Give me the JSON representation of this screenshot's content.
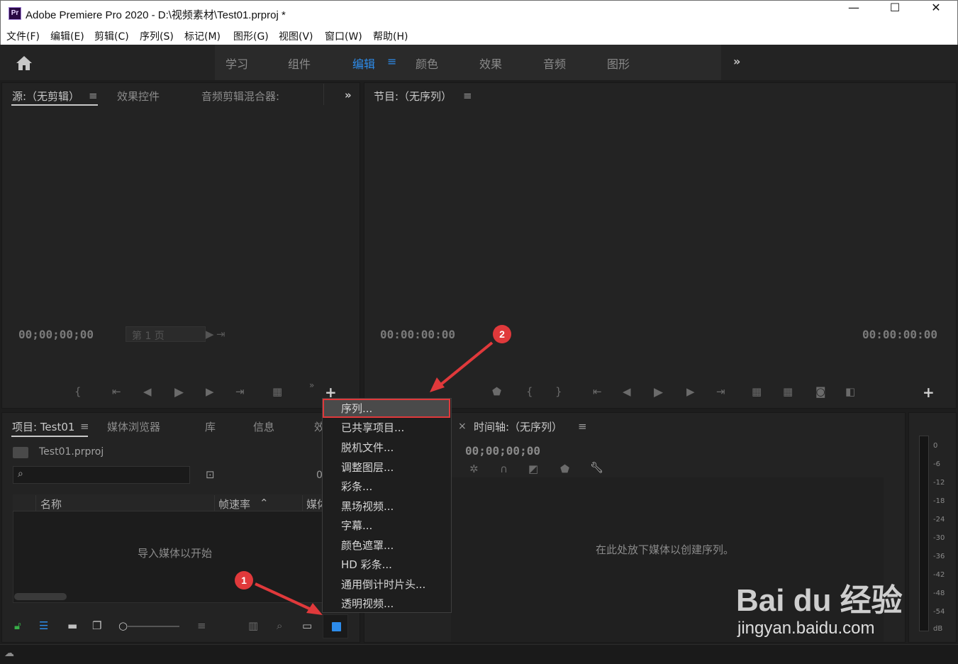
{
  "window": {
    "app_icon_text": "Pr",
    "title": "Adobe Premiere Pro 2020 - D:\\视频素材\\Test01.prproj *",
    "minimize": "—",
    "maximize": "☐",
    "close": "✕"
  },
  "menubar": [
    "文件(F)",
    "编辑(E)",
    "剪辑(C)",
    "序列(S)",
    "标记(M)",
    "图形(G)",
    "视图(V)",
    "窗口(W)",
    "帮助(H)"
  ],
  "workspaces": {
    "tabs": [
      "学习",
      "组件",
      "编辑",
      "颜色",
      "效果",
      "音频",
      "图形"
    ],
    "active": "编辑",
    "overflow": "»"
  },
  "source_panel": {
    "tabs": [
      "源:（无剪辑）",
      "效果控件",
      "音频剪辑混合器:"
    ],
    "timecode": "00;00;00;00",
    "page_label": "第 1 页",
    "overflow": "»"
  },
  "program_panel": {
    "tab": "节目:（无序列）",
    "timecode_left": "00:00:00:00",
    "timecode_right": "00:00:00:00"
  },
  "project_panel": {
    "tabs": [
      "项目: Test01",
      "媒体浏览器",
      "库",
      "信息",
      "效"
    ],
    "file_name": "Test01.prproj",
    "count": "0",
    "columns": [
      "名称",
      "帧速率",
      "媒体"
    ],
    "empty_text": "导入媒体以开始"
  },
  "timeline_panel": {
    "tab": "时间轴:（无序列）",
    "timecode": "00;00;00;00",
    "empty_text": "在此处放下媒体以创建序列。"
  },
  "audio_meter": {
    "ticks": [
      "0",
      "-6",
      "-12",
      "-18",
      "-24",
      "-30",
      "-36",
      "-42",
      "-48",
      "-54",
      "dB"
    ]
  },
  "new_item_menu": {
    "items": [
      "序列...",
      "已共享项目...",
      "脱机文件...",
      "调整图层...",
      "彩条...",
      "黑场视频...",
      "字幕...",
      "颜色遮罩...",
      "HD 彩条...",
      "通用倒计时片头...",
      "透明视频..."
    ],
    "highlighted": "序列..."
  },
  "annotations": {
    "step1": "1",
    "step2": "2"
  },
  "watermark": {
    "brand": "Bai du 经验",
    "url": "jingyan.baidu.com"
  },
  "colors": {
    "accent_blue": "#2d8ceb",
    "highlight_red": "#e0393b",
    "panel_bg": "#232323"
  }
}
